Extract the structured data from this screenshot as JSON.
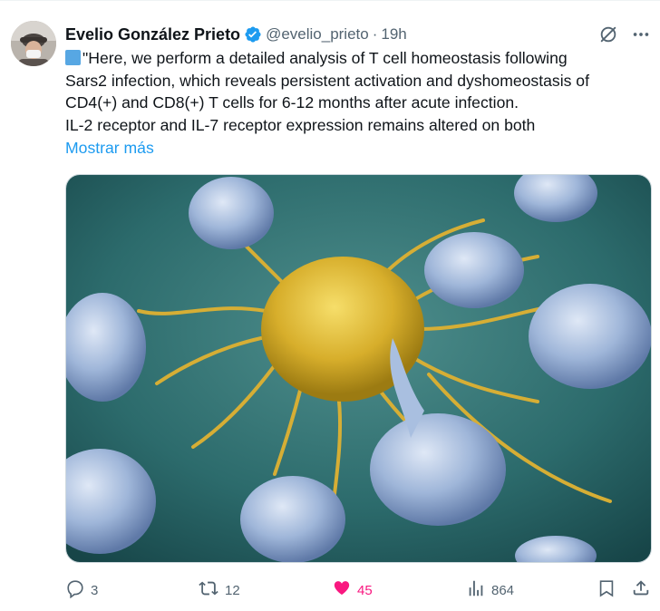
{
  "tweet": {
    "author_name": "Evelio González Prieto",
    "handle": "@evelio_prieto",
    "separator": "·",
    "time": "19h",
    "text_lines": [
      "\"Here, we perform a detailed analysis of T cell homeostasis following",
      "Sars2 infection, which reveals persistent activation and dyshomeostasis of",
      "CD4(+) and CD8(+) T cells for 6-12 months after acute infection.",
      "IL-2 receptor and IL-7 receptor expression remains altered on both"
    ],
    "show_more": "Mostrar más",
    "image_subject": "microscope illustration of immune T cells attacking a cancer cell",
    "actions": {
      "replies": "3",
      "reposts": "12",
      "likes": "45",
      "views": "864"
    },
    "colors": {
      "link": "#1d9bf0",
      "like": "#f91880",
      "muted": "#536471",
      "verified": "#1d9bf0"
    }
  }
}
